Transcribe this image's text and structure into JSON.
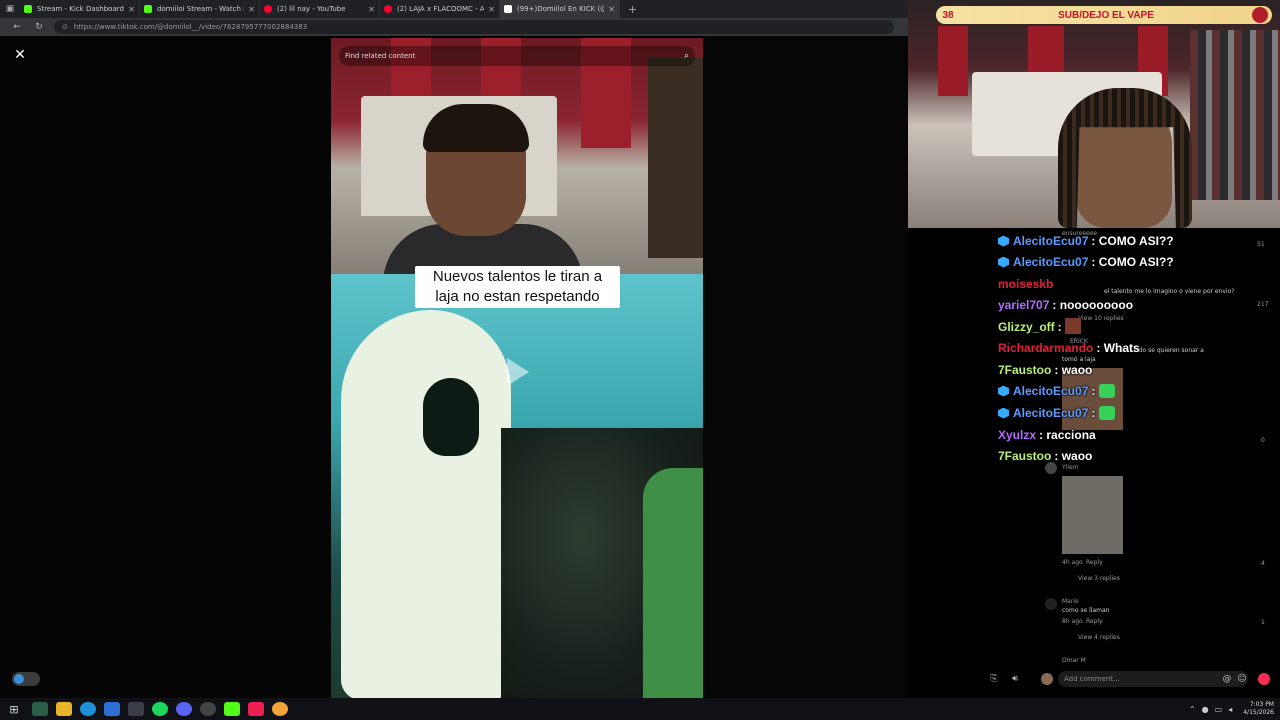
{
  "browser": {
    "tabs": [
      {
        "label": "Stream - Kick Dashboard",
        "color": "#53fc18"
      },
      {
        "label": "domiiloi Stream - Watch Live on",
        "color": "#53fc18"
      },
      {
        "label": "(2) lil nay - YouTube",
        "color": "#ff0033"
      },
      {
        "label": "(2) LAJA x FLACOOMC - ALTERA",
        "color": "#ff0033"
      },
      {
        "label": "(99+)Domiilol En KICK (@domiilo",
        "color": "#ffffff"
      }
    ],
    "new_tab": "+",
    "url": "https://www.tiktok.com/@domiilol__/video/7628795777002884383"
  },
  "video": {
    "search_placeholder": "Find related content",
    "caption_line1": "Nuevos talentos le tiran a",
    "caption_line2": "laja no estan respetando"
  },
  "stream_overlay": {
    "sub_count": "38",
    "sub_text": "SUB/DEJO EL VAPE"
  },
  "chat": [
    {
      "user": "AlecitoEcu07",
      "msg": "COMO ASI??",
      "color": "#5b9bff",
      "badge": true,
      "emote": false
    },
    {
      "user": "AlecitoEcu07",
      "msg": "COMO ASI??",
      "color": "#5b9bff",
      "badge": true,
      "emote": false
    },
    {
      "user": "moiseskb",
      "msg": "",
      "color": "#e0203c",
      "badge": false,
      "emote": false
    },
    {
      "user": "yariel707",
      "msg": "nooooooooo",
      "color": "#b36bff",
      "badge": false,
      "emote": false
    },
    {
      "user": "Glizzy_off",
      "msg": "",
      "color": "#b7f07a",
      "badge": false,
      "emote": false
    },
    {
      "user": "Richardarmando",
      "msg": "Whats",
      "color": "#e0203c",
      "badge": false,
      "emote": false
    },
    {
      "user": "7Faustoo",
      "msg": "waoo",
      "color": "#b7f07a",
      "badge": false,
      "emote": false
    },
    {
      "user": "AlecitoEcu07",
      "msg": "",
      "color": "#5b9bff",
      "badge": true,
      "emote": true
    },
    {
      "user": "AlecitoEcu07",
      "msg": "",
      "color": "#5b9bff",
      "badge": true,
      "emote": true
    },
    {
      "user": "Xyulzx",
      "msg": "racciona",
      "color": "#b36bff",
      "badge": false,
      "emote": false
    },
    {
      "user": "7Faustoo",
      "msg": "waoo",
      "color": "#b7f07a",
      "badge": false,
      "emote": false
    }
  ],
  "tiktok_comments": {
    "c1_user": "ensureeeee",
    "c1_likes": "51",
    "c2_text": "el talento me lo imagino o viene por envio?",
    "c2_likes": "217",
    "c2_replies": "View 10 replies",
    "c3_user": "ERICK",
    "c3_text": "el mundo se quieren sonar a",
    "c3_text2": "tomó a laja",
    "c4_likes": "0",
    "c5_user": "Yliem",
    "c5_meta": "4h ago",
    "c5_reply": "Reply",
    "c5_likes": "4",
    "c5_replies": "View 3 replies",
    "c6_user": "Mario",
    "c6_text": "como se llaman",
    "c6_meta": "8h ago",
    "c6_reply": "Reply",
    "c6_likes": "1",
    "c6_replies": "View 4 replies",
    "c7_user": "Omar M",
    "input_placeholder": "Add comment..."
  },
  "taskbar": {
    "time": "7:03 PM",
    "date": "4/15/2026"
  }
}
